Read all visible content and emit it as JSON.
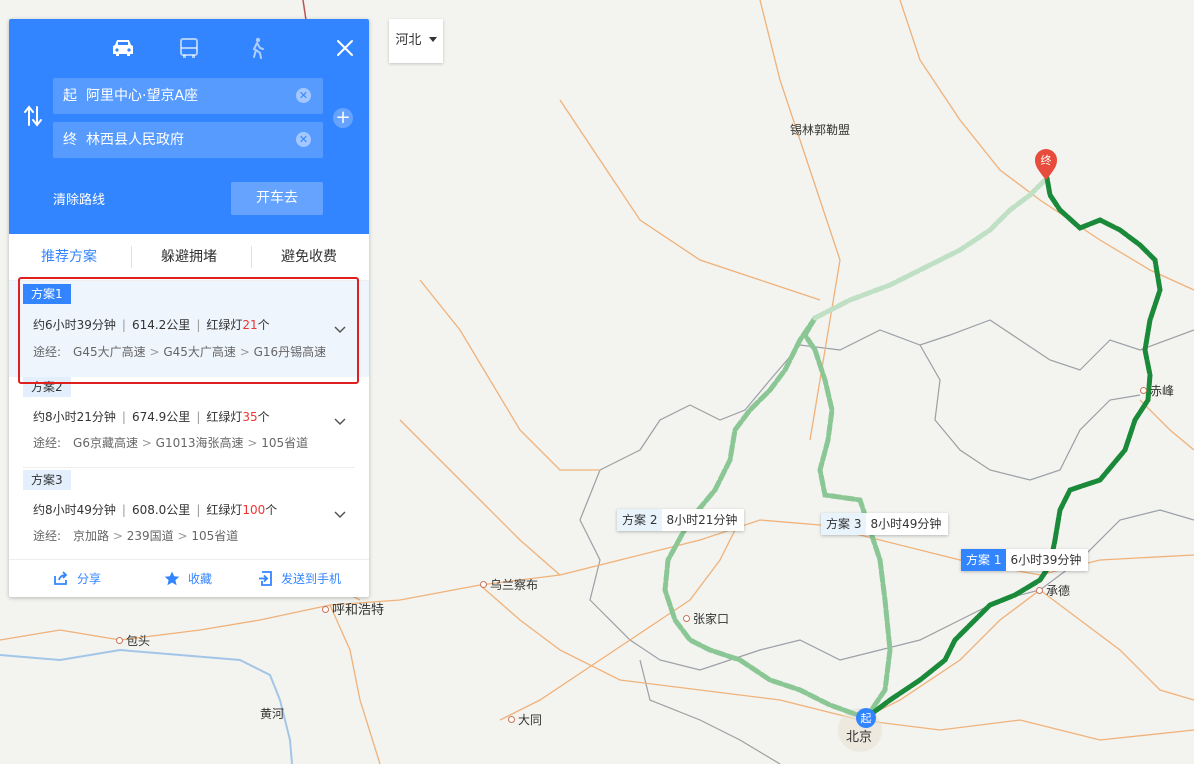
{
  "header": {
    "modes": [
      {
        "name": "car-icon",
        "active": true
      },
      {
        "name": "bus-icon",
        "active": false
      },
      {
        "name": "walk-icon",
        "active": false
      }
    ],
    "start": {
      "tag": "起",
      "value": "阿里中心·望京A座"
    },
    "end": {
      "tag": "终",
      "value": "林西县人民政府"
    },
    "clear_route": "清除路线",
    "go_button": "开车去"
  },
  "tabs": [
    "推荐方案",
    "躲避拥堵",
    "避免收费"
  ],
  "plans": [
    {
      "badge": "方案1",
      "time": "约6小时39分钟",
      "distance": "614.2公里",
      "lights_prefix": "红绿灯",
      "lights": "21",
      "lights_suffix": "个",
      "via_label": "途经:",
      "via": [
        "G45大广高速",
        "G45大广高速",
        "G16丹锡高速"
      ]
    },
    {
      "badge": "方案2",
      "time": "约8小时21分钟",
      "distance": "674.9公里",
      "lights_prefix": "红绿灯",
      "lights": "35",
      "lights_suffix": "个",
      "via_label": "途经:",
      "via": [
        "G6京藏高速",
        "G1013海张高速",
        "105省道"
      ]
    },
    {
      "badge": "方案3",
      "time": "约8小时49分钟",
      "distance": "608.0公里",
      "lights_prefix": "红绿灯",
      "lights": "100",
      "lights_suffix": "个",
      "via_label": "途经:",
      "via": [
        "京加路",
        "239国道",
        "105省道"
      ]
    }
  ],
  "footer": {
    "share": "分享",
    "favorite": "收藏",
    "send": "发送到手机"
  },
  "province_select": "河北",
  "map": {
    "cities": {
      "xilinguole": "锡林郭勒盟",
      "chifeng": "赤峰",
      "chengde": "承德",
      "zhangjiakou": "张家口",
      "wulanchabu": "乌兰察布",
      "huhehaote": "呼和浩特",
      "baotou": "包头",
      "huanghe": "黄河",
      "datong": "大同",
      "beijing": "北京"
    },
    "markers": {
      "start": "起",
      "end": "终"
    },
    "route_labels": [
      {
        "name": "方案 1",
        "time": "6小时39分钟"
      },
      {
        "name": "方案 2",
        "time": "8小时21分钟"
      },
      {
        "name": "方案 3",
        "time": "8小时49分钟"
      }
    ]
  },
  "colors": {
    "accent": "#3385ff",
    "route_main": "#1a8a3a",
    "route_alt": "#8ac795",
    "route_alt_light": "#bfe0c4",
    "highlight": "#e02020",
    "lights_red": "#e33333"
  }
}
